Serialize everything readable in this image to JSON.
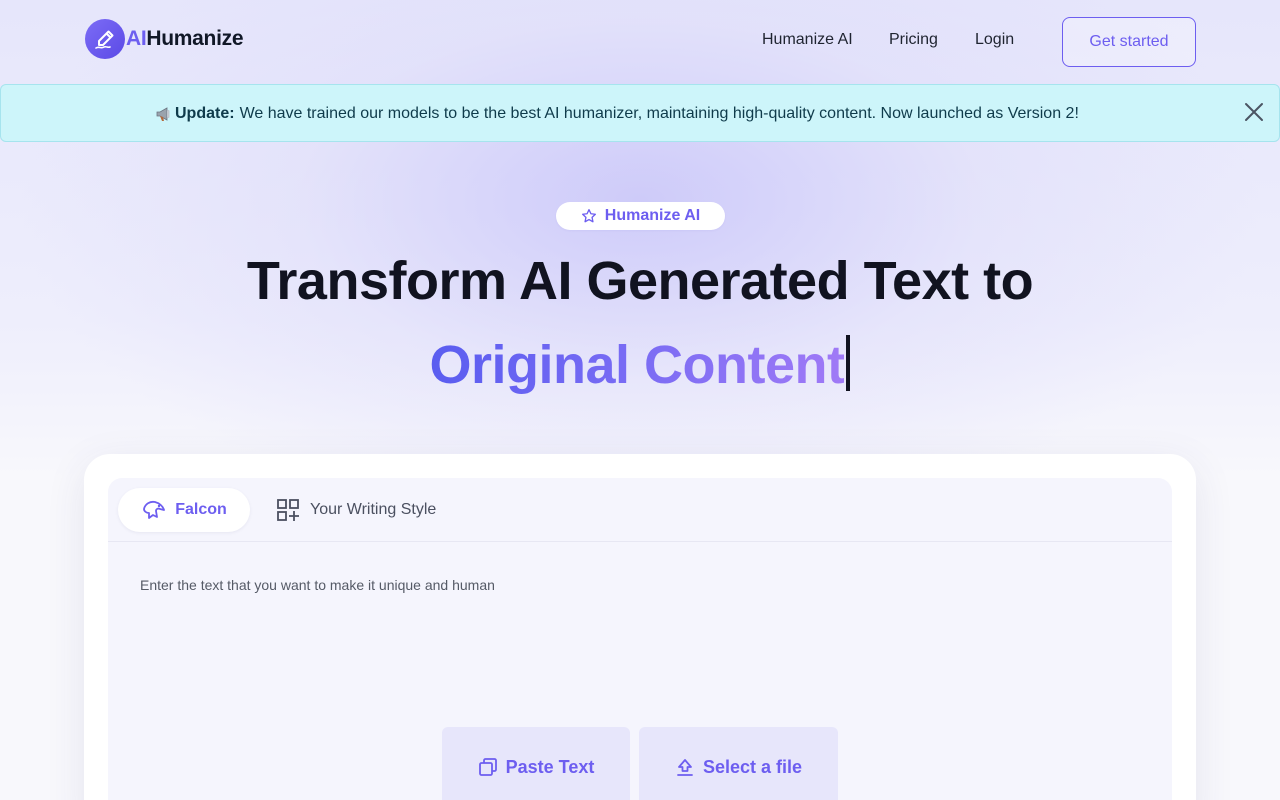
{
  "brand": {
    "prefix": "AI",
    "name": "Humanize"
  },
  "nav": {
    "links": [
      "Humanize AI",
      "Pricing",
      "Login"
    ],
    "cta_label": "Get started"
  },
  "banner": {
    "label": "Update:",
    "message": "We have trained our models to be the best AI humanizer, maintaining high-quality content. Now launched as Version 2!",
    "icon": "megaphone-icon",
    "close_icon": "close-icon"
  },
  "hero": {
    "pill_label": "Humanize AI",
    "pill_icon": "star-icon",
    "title": "Transform AI Generated Text to",
    "subtitle": "Original Content"
  },
  "editor": {
    "tabs": [
      {
        "label": "Falcon",
        "icon": "falcon-icon",
        "active": true
      },
      {
        "label": "Your Writing Style",
        "icon": "grid-plus-icon",
        "active": false
      }
    ],
    "placeholder": "Enter the text that you want to make it unique and human",
    "actions": {
      "paste_label": "Paste Text",
      "file_label": "Select a file"
    }
  },
  "colors": {
    "accent": "#6d5ef0",
    "banner_bg": "#cdf5fa",
    "gradient_start": "#5a5df0",
    "gradient_end": "#a07af6"
  }
}
